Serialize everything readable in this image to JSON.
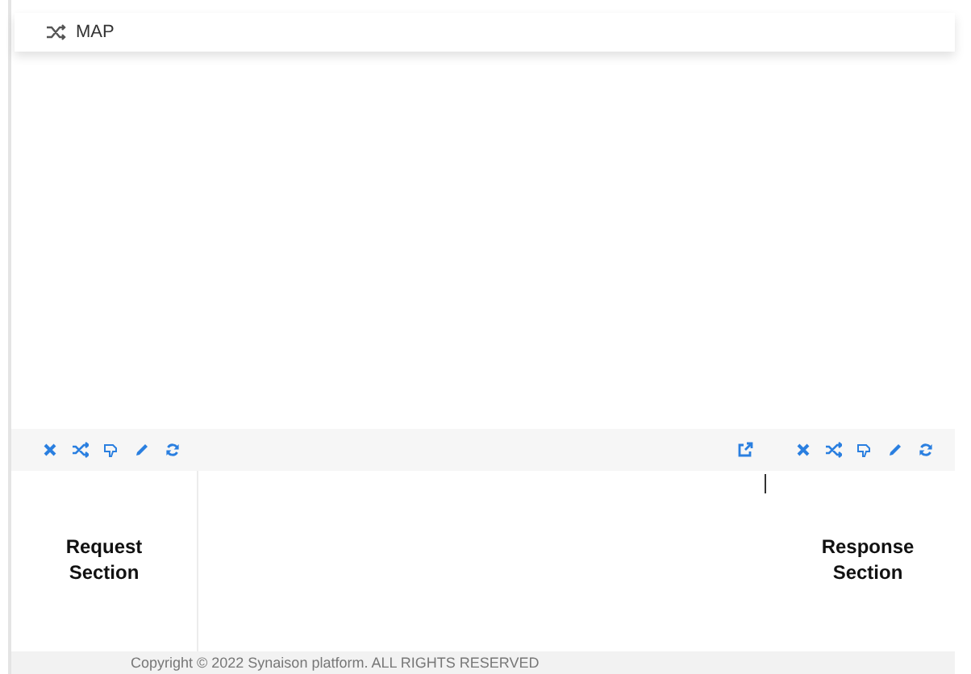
{
  "header": {
    "title": "MAP"
  },
  "request_section": {
    "label": "Request Section"
  },
  "response_section": {
    "label": "Response Section"
  },
  "footer": {
    "copyright": "Copyright © 2022 Synaison platform. ALL RIGHTS RESERVED"
  }
}
